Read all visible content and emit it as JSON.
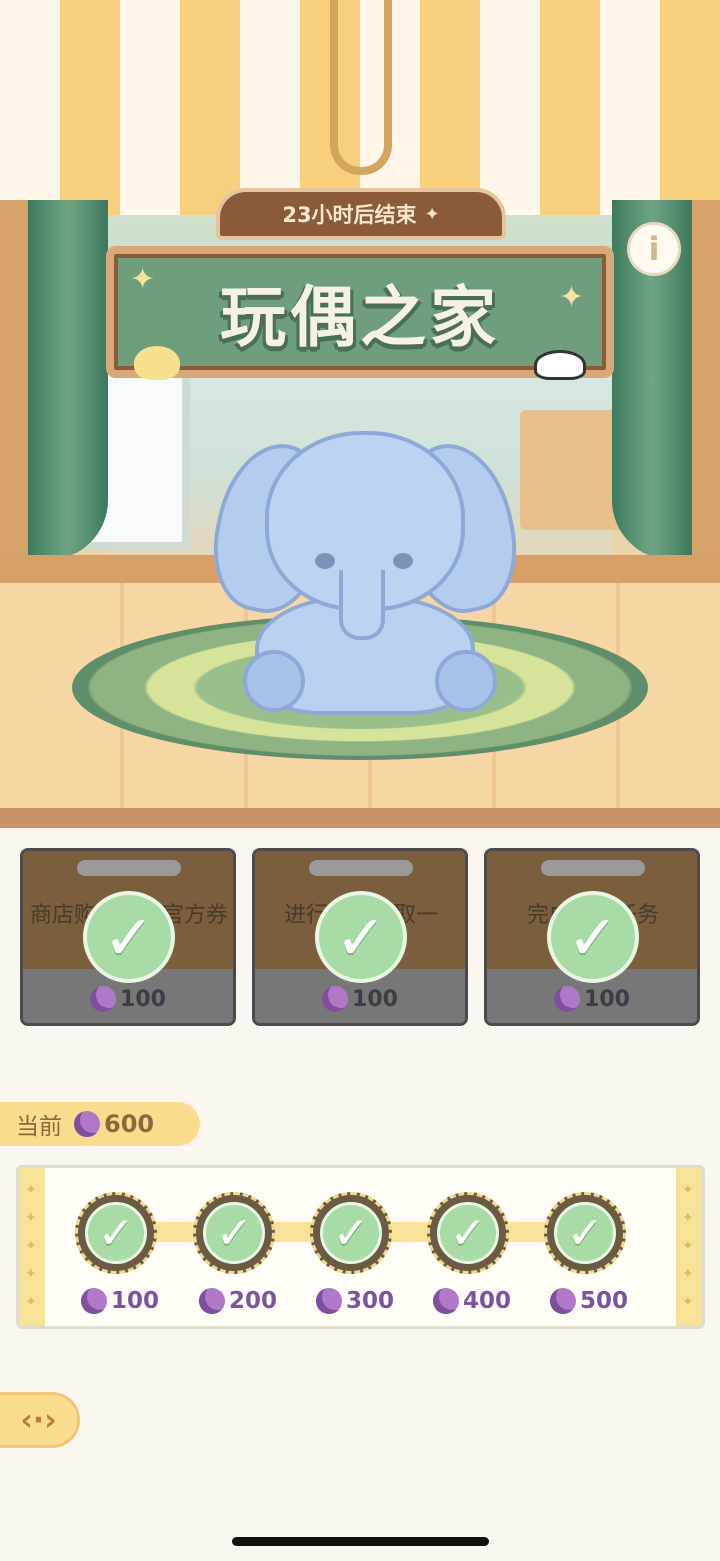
{
  "header": {
    "timer_text": "23小时后结束",
    "title": "玩偶之家"
  },
  "tasks": [
    {
      "text": "商店购买高级官方券",
      "reward": "100",
      "completed": true
    },
    {
      "text": "进行装扮领取一",
      "reward": "100",
      "completed": true
    },
    {
      "text": "完成活动任务",
      "reward": "100",
      "completed": true
    }
  ],
  "current": {
    "label": "当前",
    "value": "600"
  },
  "milestones": [
    {
      "value": "100",
      "completed": true
    },
    {
      "value": "200",
      "completed": true
    },
    {
      "value": "300",
      "completed": true
    },
    {
      "value": "400",
      "completed": true
    },
    {
      "value": "500",
      "completed": true
    }
  ],
  "icons": {
    "info": "info-icon",
    "check": "check-icon",
    "moon": "moon-currency-icon",
    "back": "back-arrow-icon"
  },
  "colors": {
    "accent_yellow": "#f9dc8e",
    "check_green": "#a9dba6",
    "currency_purple": "#7a54a0"
  }
}
